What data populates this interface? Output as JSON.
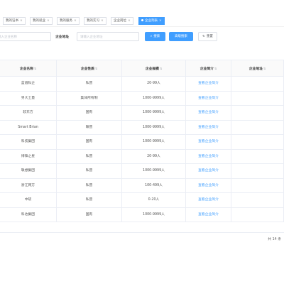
{
  "tabs": [
    {
      "label": "我的证书",
      "active": false
    },
    {
      "label": "我的就业",
      "active": false
    },
    {
      "label": "我的服务",
      "active": false
    },
    {
      "label": "我的实习",
      "active": false
    },
    {
      "label": "企业岗位",
      "active": false
    },
    {
      "label": "企业列表",
      "active": true
    }
  ],
  "tab_close_glyph": "×",
  "search": {
    "name_placeholder": "输入企业名称",
    "address_label": "企业地址",
    "address_placeholder": "请输入企业地址",
    "search_label": "搜索",
    "advanced_label": "高级搜索",
    "reset_label": "重置"
  },
  "table": {
    "headers": [
      "企业名称",
      "企业性质",
      "企业规模",
      "企业简介",
      "企业地址"
    ],
    "rows": [
      [
        "蓝眉私企",
        "私营",
        "20-99人",
        "查看企业简介",
        ""
      ],
      [
        "另大土量",
        "集体所有制",
        "1000-9999人",
        "查看企业简介",
        ""
      ],
      [
        "软东方",
        "国有",
        "1000-9999人",
        "查看企业简介",
        ""
      ],
      [
        "Smart Brian",
        "联营",
        "1000-9999人",
        "查看企业简介",
        ""
      ],
      [
        "科技集团",
        "国有",
        "1000-9999人",
        "查看企业简介",
        ""
      ],
      [
        "博锋之星",
        "私营",
        "20-99人",
        "查看企业简介",
        ""
      ],
      [
        "联想集团",
        "私营",
        "1000-9999人",
        "查看企业简介",
        ""
      ],
      [
        "浙江网方",
        "私营",
        "100-499人",
        "查看企业简介",
        ""
      ],
      [
        "中软",
        "私营",
        "0-20人",
        "查看企业简介",
        ""
      ],
      [
        "科达集团",
        "国有",
        "1000-9999人",
        "查看企业简介",
        ""
      ]
    ]
  },
  "pagination": {
    "total_text": "共 14 条"
  },
  "colors": {
    "accent": "#409eff",
    "border": "#ebeef5",
    "header_bg": "#fafafa"
  },
  "icons": {
    "search": "search-icon",
    "advanced": "filter-icon",
    "reset": "refresh-icon",
    "sort": "sort-icon"
  }
}
